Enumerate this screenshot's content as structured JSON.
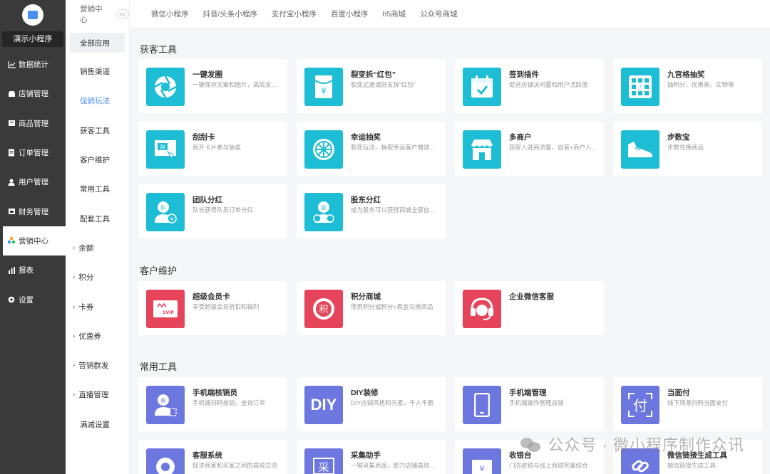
{
  "sidebar": {
    "shop_name": "演示小程序",
    "items": [
      {
        "label": "数据统计",
        "icon": "chart-line-icon"
      },
      {
        "label": "店铺管理",
        "icon": "shop-icon"
      },
      {
        "label": "商品管理",
        "icon": "box-icon"
      },
      {
        "label": "订单管理",
        "icon": "order-list-icon"
      },
      {
        "label": "用户管理",
        "icon": "user-icon"
      },
      {
        "label": "财务管理",
        "icon": "finance-icon"
      },
      {
        "label": "营销中心",
        "icon": "marketing-icon"
      },
      {
        "label": "报表",
        "icon": "bar-chart-icon"
      },
      {
        "label": "设置",
        "icon": "gear-icon"
      }
    ]
  },
  "subnav": {
    "header": "营销中心",
    "collapse": "<<",
    "items": [
      {
        "label": "全部应用"
      },
      {
        "label": "销售渠道"
      },
      {
        "label": "促销玩法"
      },
      {
        "label": "获客工具"
      },
      {
        "label": "客户维护"
      },
      {
        "label": "常用工具"
      },
      {
        "label": "配套工具"
      },
      {
        "label": "余额"
      },
      {
        "label": "积分"
      },
      {
        "label": "卡券"
      },
      {
        "label": "优惠券"
      },
      {
        "label": "营销群发"
      },
      {
        "label": "直播管理"
      },
      {
        "label": "满减设置"
      }
    ]
  },
  "top_tabs": [
    "微信小程序",
    "抖音/头条小程序",
    "支付宝小程序",
    "百度小程序",
    "h5商城",
    "公众号商城"
  ],
  "sections": [
    {
      "title": "获客工具",
      "cards": [
        {
          "title": "一键发圈",
          "desc": "一键保存文案和图片，高效发...",
          "icon": "aperture-icon"
        },
        {
          "title": "裂变拆“红包”",
          "desc": "裂变式邀请好友拆“红包”",
          "icon": "red-envelope-icon"
        },
        {
          "title": "签到插件",
          "desc": "促进店铺访问量和用户活跃度",
          "icon": "calendar-check-icon"
        },
        {
          "title": "九宫格抽奖",
          "desc": "抽积分、优惠券、实物等",
          "icon": "grid-lottery-icon"
        },
        {
          "title": "刮刮卡",
          "desc": "刮开卡片参与抽奖",
          "icon": "scratch-card-icon"
        },
        {
          "title": "幸运抽奖",
          "desc": "裂变玩法，抽取幸运客户赠送...",
          "icon": "wheel-icon"
        },
        {
          "title": "多商户",
          "desc": "获取入驻商流量，自营+商户入...",
          "icon": "storefront-icon"
        },
        {
          "title": "步数宝",
          "desc": "步数兑换商品",
          "icon": "shoe-icon"
        },
        {
          "title": "团队分红",
          "desc": "队长获得队员订单分红",
          "icon": "team-dividend-icon"
        },
        {
          "title": "股东分红",
          "desc": "成为股东可以获得商城全部自...",
          "icon": "shareholder-icon"
        }
      ]
    },
    {
      "title": "客户维护",
      "cards": [
        {
          "title": "超级会员卡",
          "desc": "享受超级会员折扣和福利",
          "icon": "svip-card-icon",
          "badge": "SVIP"
        },
        {
          "title": "积分商城",
          "desc": "使用积分或积分+现金兑换商品",
          "icon": "points-icon",
          "badge": "积"
        },
        {
          "title": "企业微信客服",
          "desc": "",
          "icon": "headset-icon"
        }
      ]
    },
    {
      "title": "常用工具",
      "cards": [
        {
          "title": "手机端核销员",
          "desc": "手机端扫码核销，查询订单",
          "icon": "verify-user-icon",
          "badge": "核"
        },
        {
          "title": "DIY装修",
          "desc": "DIY店铺风格和元素，千人千面",
          "icon": "diy-icon",
          "badge": "DIY"
        },
        {
          "title": "手机端管理",
          "desc": "手机端操作管理店铺",
          "icon": "phone-icon"
        },
        {
          "title": "当面付",
          "desc": "线下场景扫码当面支付",
          "icon": "pay-icon",
          "badge": "付"
        },
        {
          "title": "客服系统",
          "desc": "促进商家和买家之间的高效交流",
          "icon": "service-icon"
        },
        {
          "title": "采集助手",
          "desc": "一键采集商品，助力店铺高效...",
          "icon": "collect-icon",
          "badge": "采"
        },
        {
          "title": "收银台",
          "desc": "门店收银与线上商城完美结合",
          "icon": "cashier-icon",
          "badge": "¥"
        },
        {
          "title": "微信链接生成工具",
          "desc": "微信链接生成工具",
          "icon": "link-icon"
        }
      ]
    }
  ],
  "watermark": "公众号 · 微小程序制作众讯",
  "colors": {
    "teal": "#1ebdd6",
    "red": "#e6445a",
    "indigo": "#6d77e0",
    "sidebar": "#3a3a3a",
    "accent": "#4a8ef0"
  }
}
